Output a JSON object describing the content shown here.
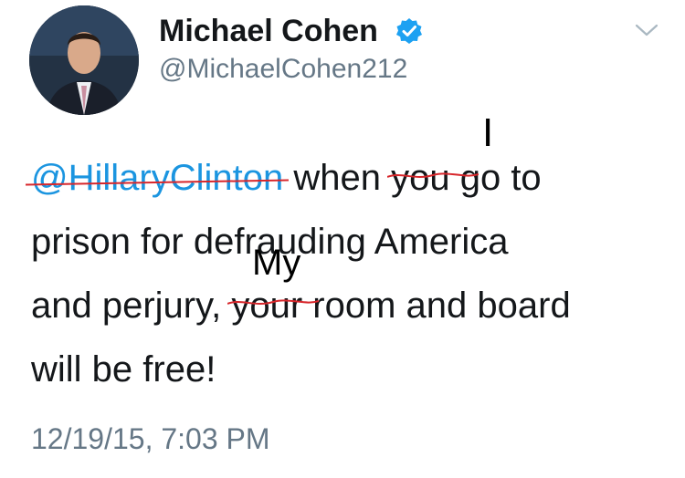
{
  "author": {
    "display_name": "Michael Cohen",
    "handle": "@MichaelCohen212",
    "verified": true
  },
  "tweet": {
    "mention": "@HillaryClinton",
    "line1_after_mention": " when ",
    "struck_word_1": "you",
    "line1_end": " go to",
    "line2": "prison for defrauding America",
    "line3_start": "and perjury, ",
    "struck_word_2": "your",
    "line3_end": " room and board",
    "line4": "will be free!",
    "handwritten_insert_1": "I",
    "handwritten_insert_2": "My"
  },
  "timestamp": "12/19/15, 7:03 PM",
  "icons": {
    "verified": "verified-badge-icon",
    "menu": "chevron-down-icon",
    "avatar": "avatar-photo"
  },
  "colors": {
    "mention": "#1b95e0",
    "verified": "#1da1f2",
    "secondary_text": "#657786",
    "strike": "#d7262b"
  }
}
